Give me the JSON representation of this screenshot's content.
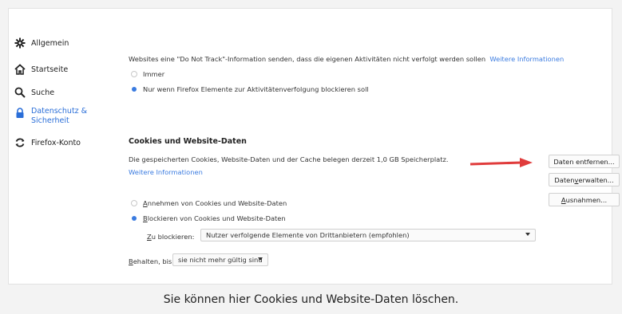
{
  "sidebar": {
    "items": [
      {
        "label": "Allgemein",
        "icon": "gear-icon"
      },
      {
        "label": "Startseite",
        "icon": "home-icon"
      },
      {
        "label": "Suche",
        "icon": "search-icon"
      },
      {
        "label": "Datenschutz &",
        "label2": "Sicherheit",
        "icon": "lock-icon",
        "active": true
      },
      {
        "label": "Firefox-Konto",
        "icon": "sync-icon"
      }
    ]
  },
  "dnt": {
    "text": "Websites eine \"Do Not Track\"-Information senden, dass die eigenen Aktivitäten nicht verfolgt werden sollen",
    "link": "Weitere Informationen",
    "options": [
      {
        "label": "Immer",
        "selected": false
      },
      {
        "label": "Nur wenn Firefox Elemente zur Aktivitätenverfolgung blockieren soll",
        "selected": true
      }
    ]
  },
  "cookies": {
    "heading": "Cookies und Website-Daten",
    "description": "Die gespeicherten Cookies, Website-Daten und der Cache belegen derzeit 1,0 GB Speicherplatz.",
    "link": "Weitere Informationen",
    "buttons": {
      "clear": "Daten entfernen...",
      "manage_prefix": "Daten ",
      "manage_u": "v",
      "manage_suffix": "erwalten...",
      "exceptions_prefix": "",
      "exceptions_u": "A",
      "exceptions_suffix": "usnahmen..."
    },
    "options": [
      {
        "u": "A",
        "rest": "nnehmen von Cookies und Website-Daten",
        "selected": false
      },
      {
        "u": "B",
        "rest": "lockieren von Cookies und Website-Daten",
        "selected": true
      }
    ],
    "block_label_u": "Z",
    "block_label_rest": "u blockieren:",
    "block_value": "Nutzer verfolgende Elemente von Drittanbietern (empfohlen)",
    "keep_label_u": "B",
    "keep_label_rest": "ehalten, bis",
    "keep_value": "sie nicht mehr gültig sind"
  },
  "colors": {
    "accent": "#3a7be0",
    "arrow": "#e03c3c"
  },
  "caption": "Sie können hier Cookies und Website-Daten löschen."
}
